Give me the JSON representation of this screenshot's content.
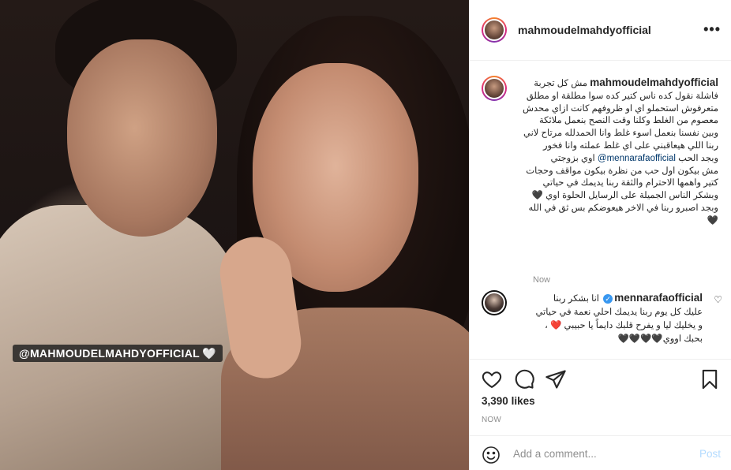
{
  "post": {
    "photo": {
      "tag": "@MAHMOUDELMAHDYOFFICIAL",
      "tag_icon": "white-heart-emoji"
    },
    "header": {
      "username": "mahmoudelmahdyofficial",
      "more_label": "•••"
    },
    "caption": {
      "username": "mahmoudelmahdyofficial",
      "lines": [
        "مش كل تجربة",
        "فاشلة نقول كده ناس كتير كده سوا مطلقة او مطلق",
        "متعرفوش استحملو اي او ظروفهم كانت ازاي محدش",
        "معصوم من الغلط وكلنا وقت النصح بنعمل ملائكة",
        "وبين نفسنا بنعمل اسوء غلط وانا الحمدلله مرتاح لاني",
        "ربنا اللي هيعاقبني على اي غلط عملته وانا فخور"
      ],
      "mention_line_before": "وبجد الحب",
      "mention": "@mennarafaofficial",
      "mention_line_after": "اوي بزوجتي",
      "lines_after": [
        "مش بيكون اول حب من نظرة بيكون مواقف وحجات",
        "كتير واهمها الاحترام والثقة ربنا يديمك في حياتي",
        "وبشكر الناس الجميلة على الرسايل الحلوة اوي 🖤",
        "وبجد اصبرو ربنا في الاخر هيعوضكم بس ثق في الله",
        "🖤"
      ],
      "time": "Now"
    },
    "comment": {
      "username": "mennarafaofficial",
      "text_lines": [
        "انا بشكر ربنا",
        "عليك كل يوم ربنا يديمك احلي نعمة في حياتي",
        "و يخليك ليا و يفرح قلبك دايماً يا حبيبي ❤️ ،",
        "بحبك اووي🖤🖤🖤🖤"
      ]
    },
    "actions": {
      "like_icon": "heart-outline-icon",
      "comment_icon": "comment-bubble-icon",
      "share_icon": "paper-plane-icon",
      "save_icon": "bookmark-icon"
    },
    "likes": {
      "count": "3,390",
      "word": "likes"
    },
    "timestamp": "NOW",
    "add_comment": {
      "emoji_icon": "smiley-icon",
      "placeholder": "Add a comment...",
      "post_label": "Post"
    },
    "colors": {
      "link": "#00376b",
      "verified": "#3897f0",
      "post_disabled": "#b3dbff",
      "muted": "#8e8e8e"
    }
  }
}
